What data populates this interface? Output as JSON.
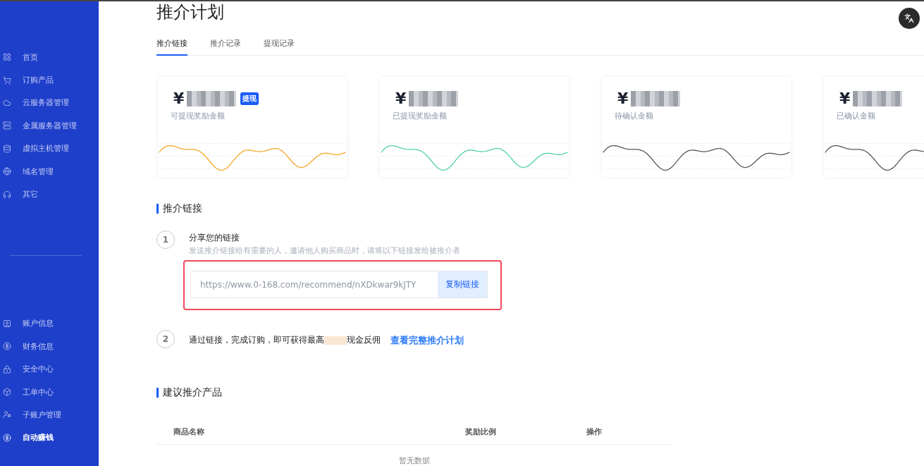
{
  "sidebar": {
    "top_items": [
      {
        "label": "首页",
        "selected": false
      },
      {
        "label": "订购产品",
        "selected": false
      },
      {
        "label": "云服务器管理",
        "selected": false
      },
      {
        "label": "金属服务器管理",
        "selected": false
      },
      {
        "label": "虚拟主机管理",
        "selected": false
      },
      {
        "label": "域名管理",
        "selected": false
      },
      {
        "label": "其它",
        "selected": false
      }
    ],
    "bottom_items": [
      {
        "label": "账户信息",
        "selected": false
      },
      {
        "label": "财务信息",
        "selected": false
      },
      {
        "label": "安全中心",
        "selected": false
      },
      {
        "label": "工单中心",
        "selected": false
      },
      {
        "label": "子账户管理",
        "selected": false
      },
      {
        "label": "自动赚钱",
        "selected": true
      }
    ]
  },
  "page_title": "推介计划",
  "tabs": [
    {
      "label": "推介链接",
      "selected": true
    },
    {
      "label": "推介记录",
      "selected": false
    },
    {
      "label": "提现记录",
      "selected": false
    }
  ],
  "cards": [
    {
      "currency": "¥",
      "label": "可提现奖励金额",
      "action": "提现",
      "color": "#f5a623"
    },
    {
      "currency": "¥",
      "label": "已提现奖励金额",
      "color": "#4fd1a0"
    },
    {
      "currency": "¥",
      "label": "待确认金额",
      "color": "#555555"
    },
    {
      "currency": "¥",
      "label": "已确认金额",
      "color": "#555555"
    }
  ],
  "link_section": {
    "heading": "推介链接",
    "step1": {
      "number": "1",
      "title": "分享您的链接",
      "description": "发送推介链接给有需要的人，邀请他人购买商品时，请将以下链接发给被推介者",
      "link_value": "https://www.0-168.com/recommend/nXDkwar9kJTY",
      "copy_button": "复制链接"
    },
    "step2": {
      "number": "2",
      "text_before": "通过链接，完成订购，即可获得最高",
      "text_after": "现金反佣",
      "link": "查看完整推介计划"
    }
  },
  "products_section": {
    "heading": "建议推介产品",
    "table": {
      "columns": [
        "商品名称",
        "奖励比例",
        "操作"
      ],
      "empty_text": "暂无数据"
    }
  }
}
